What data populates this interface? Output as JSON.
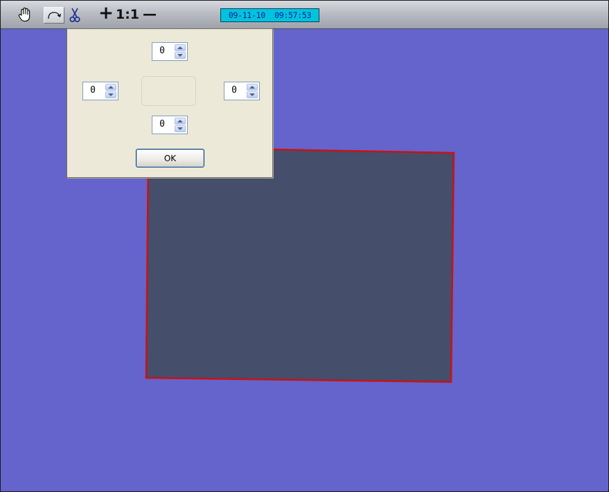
{
  "toolbar": {
    "buttons": [
      {
        "icon": "hand-icon"
      },
      {
        "icon": "rotate-icon"
      },
      {
        "icon": "scissors-icon"
      },
      {
        "icon": "zoom-in-icon",
        "label": "+"
      },
      {
        "icon": "zoom-actual-size",
        "label": "1:1"
      },
      {
        "icon": "zoom-out-icon"
      }
    ],
    "timestamp": "09-11-10  09:57:53"
  },
  "colors": {
    "background": "#6464cc",
    "region_fill": "#454e6b",
    "region_border": "#cc1111",
    "timestamp_bg": "#00c3dd",
    "dialog_bg": "#ece9d8"
  },
  "crop_dialog": {
    "top_value": "0",
    "left_value": "0",
    "right_value": "0",
    "bottom_value": "0",
    "ok_label": "OK"
  }
}
